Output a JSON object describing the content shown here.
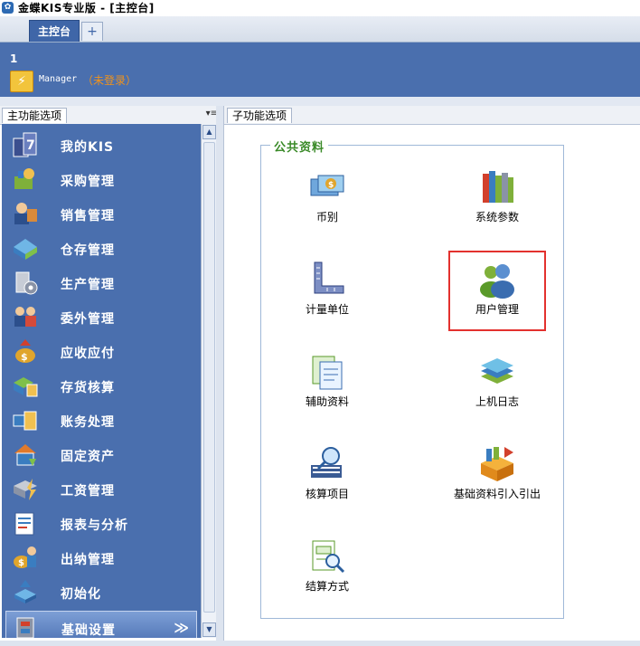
{
  "window": {
    "title": "金蝶KIS专业版 - [主控台]"
  },
  "tabs": {
    "main": "主控台",
    "add": "+"
  },
  "user": {
    "id": "1",
    "name": "Manager",
    "status": "（未登录）"
  },
  "left_panel": {
    "header": "主功能选项",
    "control": "▾≡",
    "items": [
      {
        "label": "我的KIS",
        "icon": "my-kis-icon"
      },
      {
        "label": "采购管理",
        "icon": "purchase-icon"
      },
      {
        "label": "销售管理",
        "icon": "sales-icon"
      },
      {
        "label": "仓存管理",
        "icon": "warehouse-icon"
      },
      {
        "label": "生产管理",
        "icon": "production-icon"
      },
      {
        "label": "委外管理",
        "icon": "outsourcing-icon"
      },
      {
        "label": "应收应付",
        "icon": "receivable-payable-icon"
      },
      {
        "label": "存货核算",
        "icon": "inventory-accounting-icon"
      },
      {
        "label": "账务处理",
        "icon": "ledger-icon"
      },
      {
        "label": "固定资产",
        "icon": "fixed-assets-icon"
      },
      {
        "label": "工资管理",
        "icon": "payroll-icon"
      },
      {
        "label": "报表与分析",
        "icon": "report-icon"
      },
      {
        "label": "出纳管理",
        "icon": "cashier-icon"
      },
      {
        "label": "初始化",
        "icon": "initialize-icon"
      },
      {
        "label": "基础设置",
        "icon": "basic-settings-icon",
        "active": true
      }
    ]
  },
  "right_panel": {
    "header": "子功能选项",
    "group_title": "公共资料",
    "functions": [
      {
        "label": "币别",
        "icon": "currency-icon"
      },
      {
        "label": "系统参数",
        "icon": "system-parameters-icon"
      },
      {
        "label": "计量单位",
        "icon": "measurement-unit-icon"
      },
      {
        "label": "用户管理",
        "icon": "user-management-icon",
        "highlighted": true
      },
      {
        "label": "辅助资料",
        "icon": "auxiliary-data-icon"
      },
      {
        "label": "上机日志",
        "icon": "log-icon"
      },
      {
        "label": "核算项目",
        "icon": "accounting-items-icon"
      },
      {
        "label": "基础资料引入引出",
        "icon": "import-export-icon"
      },
      {
        "label": "结算方式",
        "icon": "settlement-icon"
      }
    ]
  },
  "colors": {
    "nav_bg": "#4a6fae",
    "highlight": "#e3312e",
    "group_title": "#3a8a28",
    "status": "#f0931c"
  }
}
